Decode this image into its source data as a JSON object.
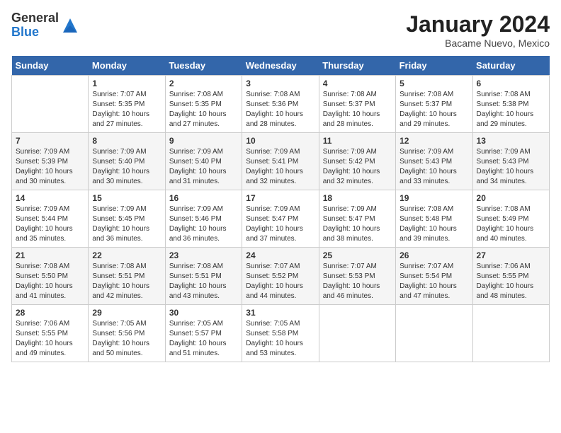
{
  "header": {
    "logo_general": "General",
    "logo_blue": "Blue",
    "month_title": "January 2024",
    "location": "Bacame Nuevo, Mexico"
  },
  "days_of_week": [
    "Sunday",
    "Monday",
    "Tuesday",
    "Wednesday",
    "Thursday",
    "Friday",
    "Saturday"
  ],
  "weeks": [
    [
      {
        "day": "",
        "info": ""
      },
      {
        "day": "1",
        "info": "Sunrise: 7:07 AM\nSunset: 5:35 PM\nDaylight: 10 hours\nand 27 minutes."
      },
      {
        "day": "2",
        "info": "Sunrise: 7:08 AM\nSunset: 5:35 PM\nDaylight: 10 hours\nand 27 minutes."
      },
      {
        "day": "3",
        "info": "Sunrise: 7:08 AM\nSunset: 5:36 PM\nDaylight: 10 hours\nand 28 minutes."
      },
      {
        "day": "4",
        "info": "Sunrise: 7:08 AM\nSunset: 5:37 PM\nDaylight: 10 hours\nand 28 minutes."
      },
      {
        "day": "5",
        "info": "Sunrise: 7:08 AM\nSunset: 5:37 PM\nDaylight: 10 hours\nand 29 minutes."
      },
      {
        "day": "6",
        "info": "Sunrise: 7:08 AM\nSunset: 5:38 PM\nDaylight: 10 hours\nand 29 minutes."
      }
    ],
    [
      {
        "day": "7",
        "info": "Sunrise: 7:09 AM\nSunset: 5:39 PM\nDaylight: 10 hours\nand 30 minutes."
      },
      {
        "day": "8",
        "info": "Sunrise: 7:09 AM\nSunset: 5:40 PM\nDaylight: 10 hours\nand 30 minutes."
      },
      {
        "day": "9",
        "info": "Sunrise: 7:09 AM\nSunset: 5:40 PM\nDaylight: 10 hours\nand 31 minutes."
      },
      {
        "day": "10",
        "info": "Sunrise: 7:09 AM\nSunset: 5:41 PM\nDaylight: 10 hours\nand 32 minutes."
      },
      {
        "day": "11",
        "info": "Sunrise: 7:09 AM\nSunset: 5:42 PM\nDaylight: 10 hours\nand 32 minutes."
      },
      {
        "day": "12",
        "info": "Sunrise: 7:09 AM\nSunset: 5:43 PM\nDaylight: 10 hours\nand 33 minutes."
      },
      {
        "day": "13",
        "info": "Sunrise: 7:09 AM\nSunset: 5:43 PM\nDaylight: 10 hours\nand 34 minutes."
      }
    ],
    [
      {
        "day": "14",
        "info": "Sunrise: 7:09 AM\nSunset: 5:44 PM\nDaylight: 10 hours\nand 35 minutes."
      },
      {
        "day": "15",
        "info": "Sunrise: 7:09 AM\nSunset: 5:45 PM\nDaylight: 10 hours\nand 36 minutes."
      },
      {
        "day": "16",
        "info": "Sunrise: 7:09 AM\nSunset: 5:46 PM\nDaylight: 10 hours\nand 36 minutes."
      },
      {
        "day": "17",
        "info": "Sunrise: 7:09 AM\nSunset: 5:47 PM\nDaylight: 10 hours\nand 37 minutes."
      },
      {
        "day": "18",
        "info": "Sunrise: 7:09 AM\nSunset: 5:47 PM\nDaylight: 10 hours\nand 38 minutes."
      },
      {
        "day": "19",
        "info": "Sunrise: 7:08 AM\nSunset: 5:48 PM\nDaylight: 10 hours\nand 39 minutes."
      },
      {
        "day": "20",
        "info": "Sunrise: 7:08 AM\nSunset: 5:49 PM\nDaylight: 10 hours\nand 40 minutes."
      }
    ],
    [
      {
        "day": "21",
        "info": "Sunrise: 7:08 AM\nSunset: 5:50 PM\nDaylight: 10 hours\nand 41 minutes."
      },
      {
        "day": "22",
        "info": "Sunrise: 7:08 AM\nSunset: 5:51 PM\nDaylight: 10 hours\nand 42 minutes."
      },
      {
        "day": "23",
        "info": "Sunrise: 7:08 AM\nSunset: 5:51 PM\nDaylight: 10 hours\nand 43 minutes."
      },
      {
        "day": "24",
        "info": "Sunrise: 7:07 AM\nSunset: 5:52 PM\nDaylight: 10 hours\nand 44 minutes."
      },
      {
        "day": "25",
        "info": "Sunrise: 7:07 AM\nSunset: 5:53 PM\nDaylight: 10 hours\nand 46 minutes."
      },
      {
        "day": "26",
        "info": "Sunrise: 7:07 AM\nSunset: 5:54 PM\nDaylight: 10 hours\nand 47 minutes."
      },
      {
        "day": "27",
        "info": "Sunrise: 7:06 AM\nSunset: 5:55 PM\nDaylight: 10 hours\nand 48 minutes."
      }
    ],
    [
      {
        "day": "28",
        "info": "Sunrise: 7:06 AM\nSunset: 5:55 PM\nDaylight: 10 hours\nand 49 minutes."
      },
      {
        "day": "29",
        "info": "Sunrise: 7:05 AM\nSunset: 5:56 PM\nDaylight: 10 hours\nand 50 minutes."
      },
      {
        "day": "30",
        "info": "Sunrise: 7:05 AM\nSunset: 5:57 PM\nDaylight: 10 hours\nand 51 minutes."
      },
      {
        "day": "31",
        "info": "Sunrise: 7:05 AM\nSunset: 5:58 PM\nDaylight: 10 hours\nand 53 minutes."
      },
      {
        "day": "",
        "info": ""
      },
      {
        "day": "",
        "info": ""
      },
      {
        "day": "",
        "info": ""
      }
    ]
  ]
}
